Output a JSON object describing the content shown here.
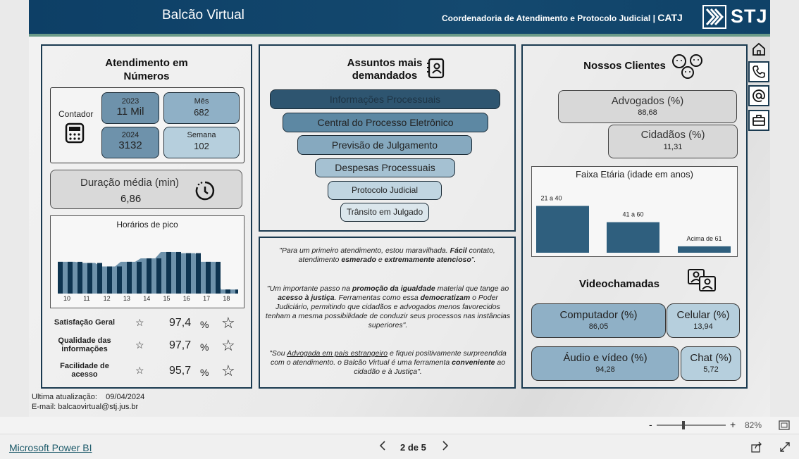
{
  "header": {
    "title": "Balcão Virtual",
    "org": "Coordenadoria de Atendimento e Protocolo Judicial | ",
    "org_short": "CATJ",
    "logo": "STJ"
  },
  "atendimento": {
    "title_line1": "Atendimento em",
    "title_line2": "Números",
    "contador_label": "Contador",
    "cells": [
      {
        "label": "2023",
        "value": "11 Mil"
      },
      {
        "label": "Mês",
        "value": "682"
      },
      {
        "label": "2024",
        "value": "3132"
      },
      {
        "label": "Semana",
        "value": "102"
      }
    ],
    "duracao_label": "Duração média (min)",
    "duracao_value": "6,86",
    "horarios_title": "Horários de pico",
    "horarios_hours": [
      "10",
      "11",
      "12",
      "13",
      "14",
      "15",
      "16",
      "17",
      "18"
    ],
    "horarios_values": [
      0.55,
      0.53,
      0.47,
      0.55,
      0.61,
      0.72,
      0.7,
      0.55,
      0.07
    ],
    "satisfacao": [
      {
        "label": "Satisfação Geral",
        "value": "97,4",
        "unit": "%"
      },
      {
        "label": "Qualidade das informações",
        "value": "97,7",
        "unit": "%"
      },
      {
        "label": "Facilidade de acesso",
        "value": "95,7",
        "unit": "%"
      }
    ]
  },
  "assuntos": {
    "title_line1": "Assuntos mais",
    "title_line2": "demandados",
    "items": [
      "Informações Processuais",
      "Central do Processo Eletrônico",
      "Previsão de Julgamento",
      "Despesas Processuais",
      "Protocolo Judicial",
      "Trânsito em Julgado"
    ],
    "colors": [
      "#2e5570",
      "#5d88a3",
      "#86a9bf",
      "#a5c1d2",
      "#c0d5e1",
      "#dbe6ec"
    ]
  },
  "quotes": {
    "q1": [
      "\"Para um primeiro atendimento, estou maravilhada. ",
      "Fácil",
      " contato, atendimento ",
      "esmerado",
      " e ",
      "extremamente atencioso",
      "\"."
    ],
    "q2": [
      "\"Um importante passo na ",
      "promoção da igualdade",
      " material que tange ao ",
      "acesso à justiça",
      ". Ferramentas como essa ",
      "democratizam",
      " o Poder Judiciário, permitindo que cidadãos e advogados menos favorecidos tenham a mesma possibilidade de conduzir seus processos nas instâncias superiores\"."
    ],
    "q3": [
      "\"Sou ",
      "Advogada em país estrangeiro",
      " e fiquei positivamente surpreendida com o atendimento. o Balcão Virtual é uma ferramenta ",
      "conveniente",
      " ao cidadão e à Justiça\"."
    ]
  },
  "clientes": {
    "title": "Nossos Clientes",
    "advogados_label": "Advogados (%)",
    "advogados_value": "88,68",
    "cidadaos_label": "Cidadãos (%)",
    "cidadaos_value": "11,31",
    "faixa_title": "Faixa Etária (idade em anos)",
    "faixa": [
      {
        "label": "21 a 40",
        "value": 0.95
      },
      {
        "label": "41 a 60",
        "value": 0.62
      },
      {
        "label": "Acima de 61",
        "value": 0.13
      }
    ],
    "video_title": "Videochamadas",
    "video": [
      {
        "label": "Computador (%)",
        "value": "86,05"
      },
      {
        "label": "Celular (%)",
        "value": "13,94"
      },
      {
        "label": "Áudio e vídeo (%)",
        "value": "94,28"
      },
      {
        "label": "Chat (%)",
        "value": "5,72"
      }
    ]
  },
  "update": {
    "label": "Ultima atualização:",
    "date": "09/04/2024",
    "email": "E-mail: balcaovirtual@stj.jus.br"
  },
  "zoom": {
    "minus": "-",
    "plus": "+",
    "value": "82%"
  },
  "footer": {
    "brand": "Microsoft Power BI",
    "page": "2 de 5"
  },
  "colors": {
    "dark": "#0d3f66",
    "bar": "#2f5f7e",
    "chart_dark": "#0e3450",
    "chart_light": "#6e92ab"
  }
}
